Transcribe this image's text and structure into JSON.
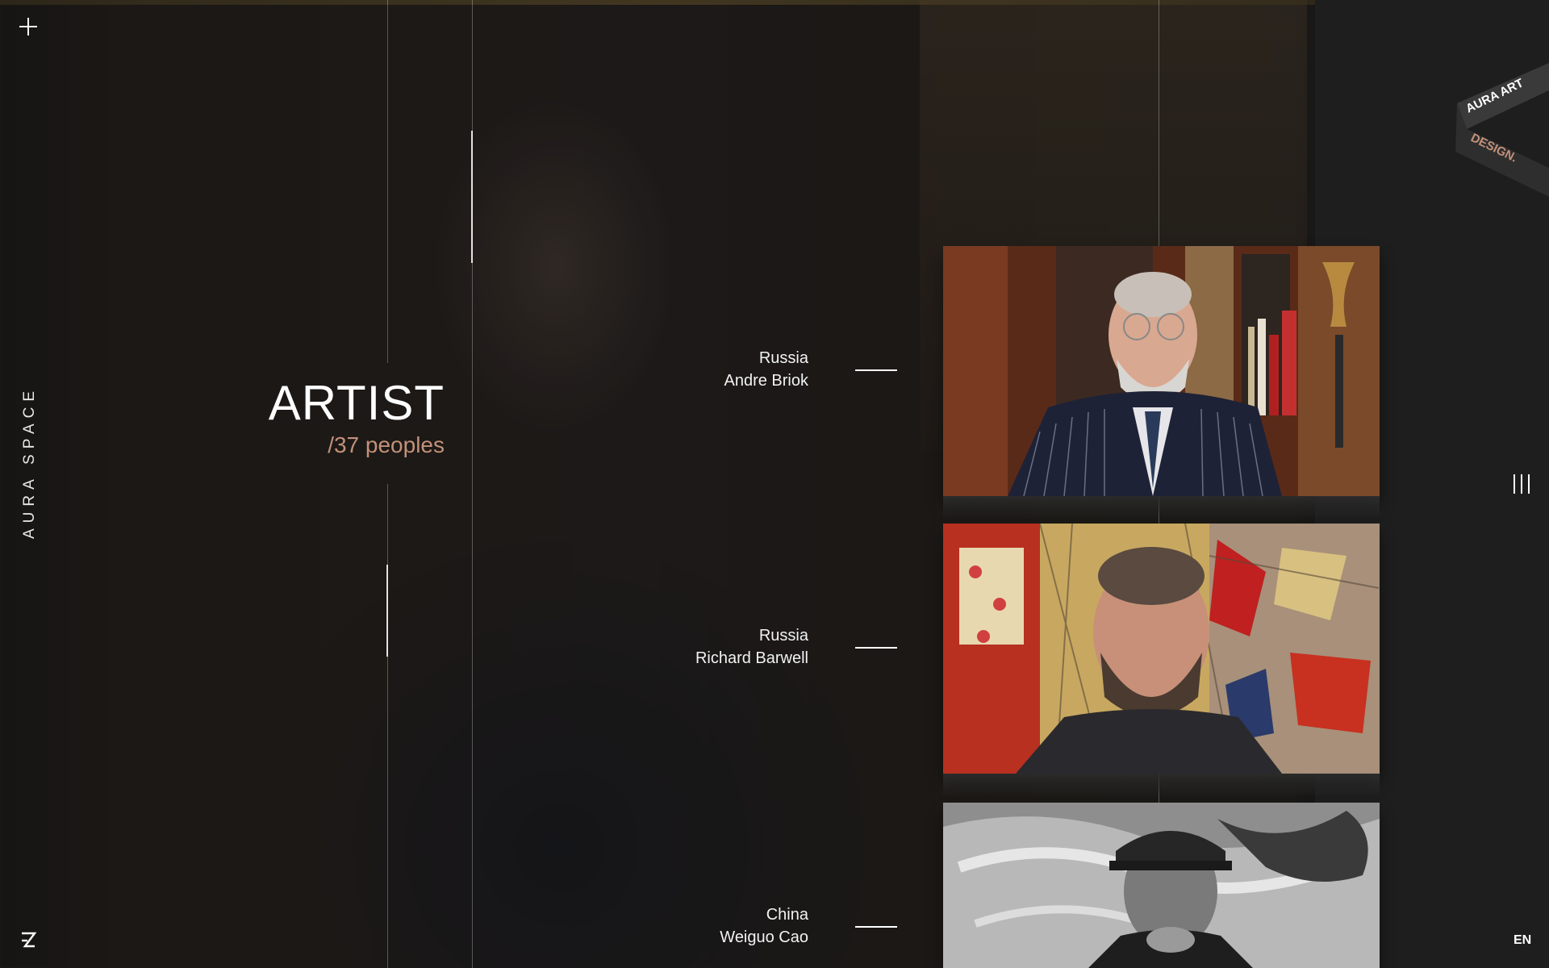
{
  "brand": {
    "side_text": "AURA SPACE",
    "ribbon_top": "AURA ART",
    "ribbon_bottom": "DESIGN."
  },
  "header": {
    "title": "ARTIST",
    "subtitle": "/37 peoples"
  },
  "artists": [
    {
      "country": "Russia",
      "name": "Andre Briok"
    },
    {
      "country": "Russia",
      "name": "Richard Barwell"
    },
    {
      "country": "China",
      "name": "Weiguo Cao"
    }
  ],
  "footer": {
    "language": "EN"
  },
  "icons": {
    "top_left": "plus-icon",
    "bottom_left": "logo-icon",
    "right_menu": "menu-bars-icon"
  },
  "colors": {
    "accent": "#c2917a",
    "background": "#1c1c1c",
    "ribbon_text_bottom": "#c2917a"
  }
}
